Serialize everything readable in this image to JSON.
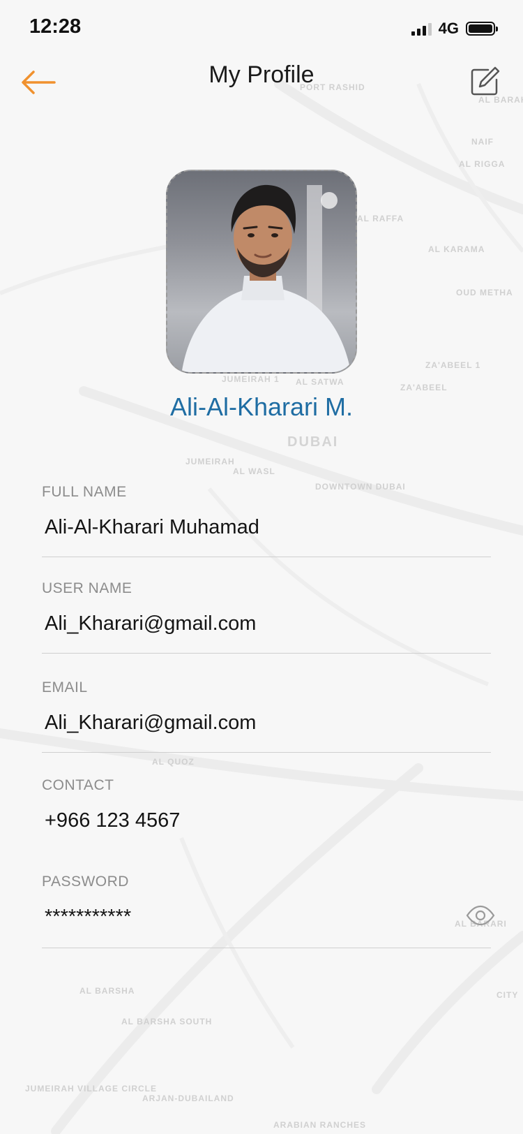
{
  "status_bar": {
    "time": "12:28",
    "network": "4G"
  },
  "header": {
    "title": "My Profile",
    "back_icon": "arrow-left-icon",
    "edit_icon": "edit-square-icon"
  },
  "profile": {
    "display_name": "Ali-Al-Kharari M."
  },
  "form": {
    "full_name": {
      "label": "FULL NAME",
      "value": "Ali-Al-Kharari Muhamad"
    },
    "user_name": {
      "label": "USER NAME",
      "value": "Ali_Kharari@gmail.com"
    },
    "email": {
      "label": "EMAIL",
      "value": "Ali_Kharari@gmail.com"
    },
    "contact": {
      "label": "CONTACT",
      "value": "+966 123 4567"
    },
    "password": {
      "label": "PASSWORD",
      "value": "***********",
      "toggle_icon": "eye-icon"
    }
  },
  "map_labels": {
    "city": "Dubai",
    "areas": [
      "PORT RASHID",
      "AL BARAH",
      "NAIF",
      "AL RIGGA",
      "AL RAFFA",
      "AL KARAMA",
      "OUD METHA",
      "ZA'ABEEL 1",
      "ZA'ABEEL",
      "JUMEIRAH 1",
      "AL SATWA",
      "JUMEIRAH",
      "AL WASL",
      "DOWNTOWN DUBAI",
      "AL QUOZ",
      "AL BARSHA",
      "AL BARSHA SOUTH",
      "JUMEIRAH VILLAGE CIRCLE",
      "ARJAN-DUBAILAND",
      "ARABIAN RANCHES",
      "AL BARARI",
      "CITY"
    ]
  },
  "colors": {
    "accent_orange": "#f0912e",
    "name_blue": "#1f6da3",
    "label_gray": "#8c8c8c",
    "divider": "#cfcfcf"
  }
}
